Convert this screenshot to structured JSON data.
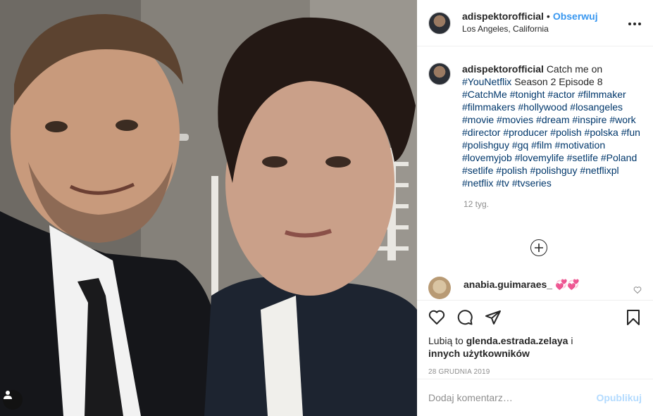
{
  "post": {
    "author": "adispektorofficial",
    "separator": "•",
    "follow_label": "Obserwuj",
    "location": "Los Angeles, California",
    "more_icon": "more-horizontal-icon"
  },
  "caption": {
    "username": "adispektorofficial",
    "text_plain": "Catch me on",
    "link1": "#YouNetflix",
    "text_after_link1": "Season 2 Episode 8",
    "hashtags": "#CatchMe #tonight #actor #filmmaker #filmmakers #hollywood #losangeles #movie #movies #dream #inspire #work #director #producer #polish #polska #fun #polishguy #gq #film #motivation #lovemyjob #lovemylife #setlife #Poland #setlife #polish #polishguy #netflixpl #netflix #tv #tvseries",
    "age": "12 tyg."
  },
  "comment": {
    "username": "anabia.guimaraes_",
    "text": "💞💞"
  },
  "actions": {
    "likes_prefix": "Lubią to",
    "likes_user": "glenda.estrada.zelaya",
    "likes_suffix": "i",
    "likes_others": "innych użytkowników",
    "date": "28 GRUDNIA 2019"
  },
  "add_comment": {
    "placeholder": "Dodaj komentarz…",
    "post_label": "Opublikuj"
  },
  "colors": {
    "link": "#00376b",
    "follow": "#3897f0",
    "post_disabled": "#b3dbff",
    "secondary_text": "#8e8e8e"
  }
}
